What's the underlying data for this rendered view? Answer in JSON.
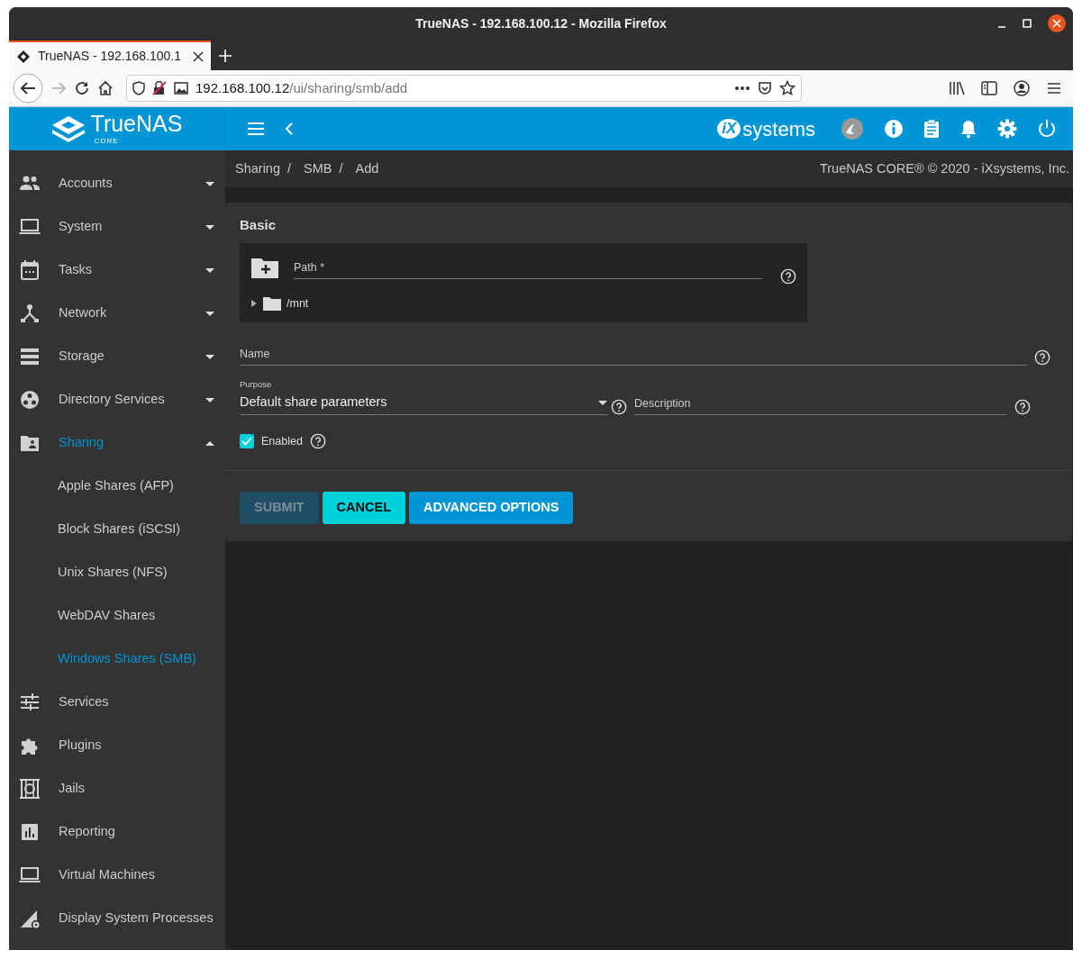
{
  "window": {
    "title": "TrueNAS - 192.168.100.12 - Mozilla Firefox"
  },
  "browser": {
    "tabs": [
      {
        "title": "TrueNAS - 192.168.100.1",
        "selected": true
      }
    ],
    "url_host": "192.168.100.12",
    "url_path": "/ui/sharing/smb/add"
  },
  "app_bar": {
    "logo": "TrueNAS",
    "logo_sub": "CORE",
    "vendor_mark": "iX",
    "vendor_word": "systems"
  },
  "sidebar": {
    "items": [
      {
        "label": "Accounts",
        "kind": "menu",
        "expanded": false,
        "selected": false
      },
      {
        "label": "System",
        "kind": "menu",
        "expanded": false,
        "selected": false
      },
      {
        "label": "Tasks",
        "kind": "menu",
        "expanded": false,
        "selected": false
      },
      {
        "label": "Network",
        "kind": "menu",
        "expanded": false,
        "selected": false
      },
      {
        "label": "Storage",
        "kind": "menu",
        "expanded": false,
        "selected": false
      },
      {
        "label": "Directory Services",
        "kind": "menu",
        "expanded": false,
        "selected": false
      },
      {
        "label": "Sharing",
        "kind": "menu",
        "expanded": true,
        "selected": true,
        "children": [
          {
            "label": "Apple Shares (AFP)",
            "selected": false
          },
          {
            "label": "Block Shares (iSCSI)",
            "selected": false
          },
          {
            "label": "Unix Shares (NFS)",
            "selected": false
          },
          {
            "label": "WebDAV Shares",
            "selected": false
          },
          {
            "label": "Windows Shares (SMB)",
            "selected": true
          }
        ]
      },
      {
        "label": "Services",
        "kind": "link",
        "selected": false
      },
      {
        "label": "Plugins",
        "kind": "link",
        "selected": false
      },
      {
        "label": "Jails",
        "kind": "link",
        "selected": false
      },
      {
        "label": "Reporting",
        "kind": "link",
        "selected": false
      },
      {
        "label": "Virtual Machines",
        "kind": "link",
        "selected": false
      },
      {
        "label": "Display System Processes",
        "kind": "link",
        "selected": false
      }
    ]
  },
  "breadcrumb": [
    {
      "label": "Sharing",
      "separator": "/"
    },
    {
      "label": "SMB",
      "separator": "/"
    },
    {
      "label": "Add"
    }
  ],
  "copyright": "TrueNAS CORE® © 2020 - iXsystems, Inc.",
  "form": {
    "section": "Basic",
    "path": {
      "placeholder": "Path *",
      "tree": [
        {
          "label": "/mnt",
          "expanded": false
        }
      ]
    },
    "name": {
      "placeholder": "Name"
    },
    "purpose": {
      "label": "Purpose",
      "value": "Default share parameters"
    },
    "description": {
      "placeholder": "Description"
    },
    "enabled": {
      "label": "Enabled",
      "checked": true
    },
    "buttons": [
      {
        "label": "SUBMIT",
        "kind": "primary",
        "disabled": true
      },
      {
        "label": "CANCEL",
        "kind": "accent",
        "disabled": false
      },
      {
        "label": "ADVANCED OPTIONS",
        "kind": "primary",
        "disabled": false
      }
    ]
  }
}
